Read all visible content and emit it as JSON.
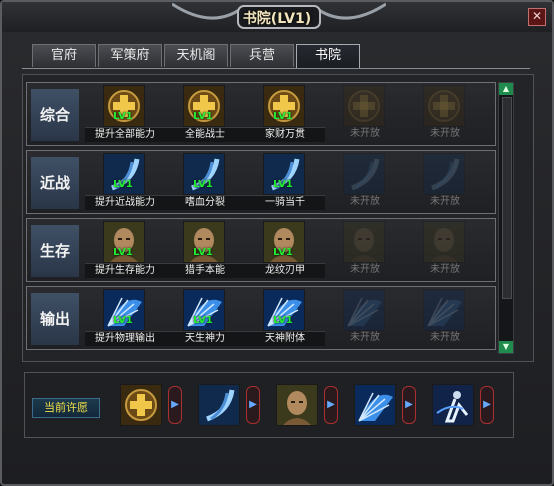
{
  "window": {
    "title": "书院(LV1)",
    "close_icon": "close-icon"
  },
  "tabs": [
    {
      "label": "官府",
      "active": false
    },
    {
      "label": "军策府",
      "active": false
    },
    {
      "label": "天机阁",
      "active": false
    },
    {
      "label": "兵营",
      "active": false
    },
    {
      "label": "书院",
      "active": true
    }
  ],
  "rows": [
    {
      "label": "综合",
      "icon": "gold-cross-icon",
      "skills": [
        {
          "level": "LV1",
          "name": "提升全部能力",
          "unlocked": true
        },
        {
          "level": "LV1",
          "name": "全能战士",
          "unlocked": true
        },
        {
          "level": "LV1",
          "name": "家财万贯",
          "unlocked": true
        },
        {
          "level": "",
          "name": "未开放",
          "unlocked": false
        },
        {
          "level": "",
          "name": "未开放",
          "unlocked": false
        }
      ]
    },
    {
      "label": "近战",
      "icon": "blade-slash-icon",
      "skills": [
        {
          "level": "LV1",
          "name": "提升近战能力",
          "unlocked": true
        },
        {
          "level": "LV1",
          "name": "嗜血分裂",
          "unlocked": true
        },
        {
          "level": "LV1",
          "name": "一骑当千",
          "unlocked": true
        },
        {
          "level": "",
          "name": "未开放",
          "unlocked": false
        },
        {
          "level": "",
          "name": "未开放",
          "unlocked": false
        }
      ]
    },
    {
      "label": "生存",
      "icon": "monk-face-icon",
      "skills": [
        {
          "level": "LV1",
          "name": "提升生存能力",
          "unlocked": true
        },
        {
          "level": "LV1",
          "name": "猎手本能",
          "unlocked": true
        },
        {
          "level": "LV1",
          "name": "龙纹刃甲",
          "unlocked": true
        },
        {
          "level": "",
          "name": "未开放",
          "unlocked": false
        },
        {
          "level": "",
          "name": "未开放",
          "unlocked": false
        }
      ]
    },
    {
      "label": "输出",
      "icon": "fan-burst-icon",
      "skills": [
        {
          "level": "LV1",
          "name": "提升物理输出",
          "unlocked": true
        },
        {
          "level": "LV1",
          "name": "天生神力",
          "unlocked": true
        },
        {
          "level": "LV1",
          "name": "天神附体",
          "unlocked": true
        },
        {
          "level": "",
          "name": "未开放",
          "unlocked": false
        },
        {
          "level": "",
          "name": "未开放",
          "unlocked": false
        }
      ]
    }
  ],
  "wish": {
    "label": "当前许愿",
    "slots": [
      "gold-cross-icon",
      "blade-slash-icon",
      "monk-face-icon",
      "fan-burst-icon",
      "shadow-warrior-icon"
    ],
    "arrow_icon": "arrow-right-icon"
  },
  "colors": {
    "level_text": "#22ee33",
    "wish_label_text": "#f4e046",
    "title_text": "#f3e6bd"
  }
}
